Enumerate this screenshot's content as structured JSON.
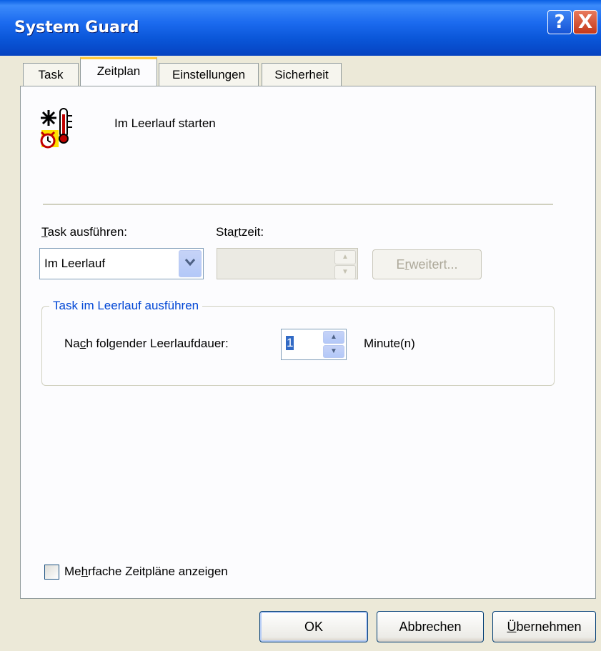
{
  "window": {
    "title": "System Guard"
  },
  "title_buttons": {
    "help": "?",
    "close": "X"
  },
  "tabs": [
    {
      "label": "Task"
    },
    {
      "label": "Zeitplan"
    },
    {
      "label": "Einstellungen"
    },
    {
      "label": "Sicherheit"
    }
  ],
  "schedule": {
    "summary": "Im Leerlauf starten",
    "run_task_label_pre": "",
    "run_task_label_mnemonic": "T",
    "run_task_label_post": "ask ausführen:",
    "run_task_value": "Im Leerlauf",
    "start_time_pre": "Sta",
    "start_time_mnemonic": "r",
    "start_time_post": "tzeit:",
    "advanced_pre": "E",
    "advanced_mnemonic": "r",
    "advanced_post": "weitert...",
    "group_title": "Task im Leerlauf ausführen",
    "idle_label_pre": "Na",
    "idle_label_mnemonic": "c",
    "idle_label_post": "h folgender Leerlaufdauer:",
    "idle_value": "1",
    "idle_unit": "Minute(n)",
    "multi_pre": "Me",
    "multi_mnemonic": "h",
    "multi_post": "rfache Zeitpläne anzeigen"
  },
  "footer": {
    "ok": "OK",
    "cancel": "Abbrechen",
    "apply_mnemonic": "Ü",
    "apply_post": "bernehmen"
  },
  "colors": {
    "titlebar": "#0A56D8",
    "close": "#C4381A",
    "active_tab_accent": "#FFC83C",
    "group_title": "#0046D5"
  }
}
